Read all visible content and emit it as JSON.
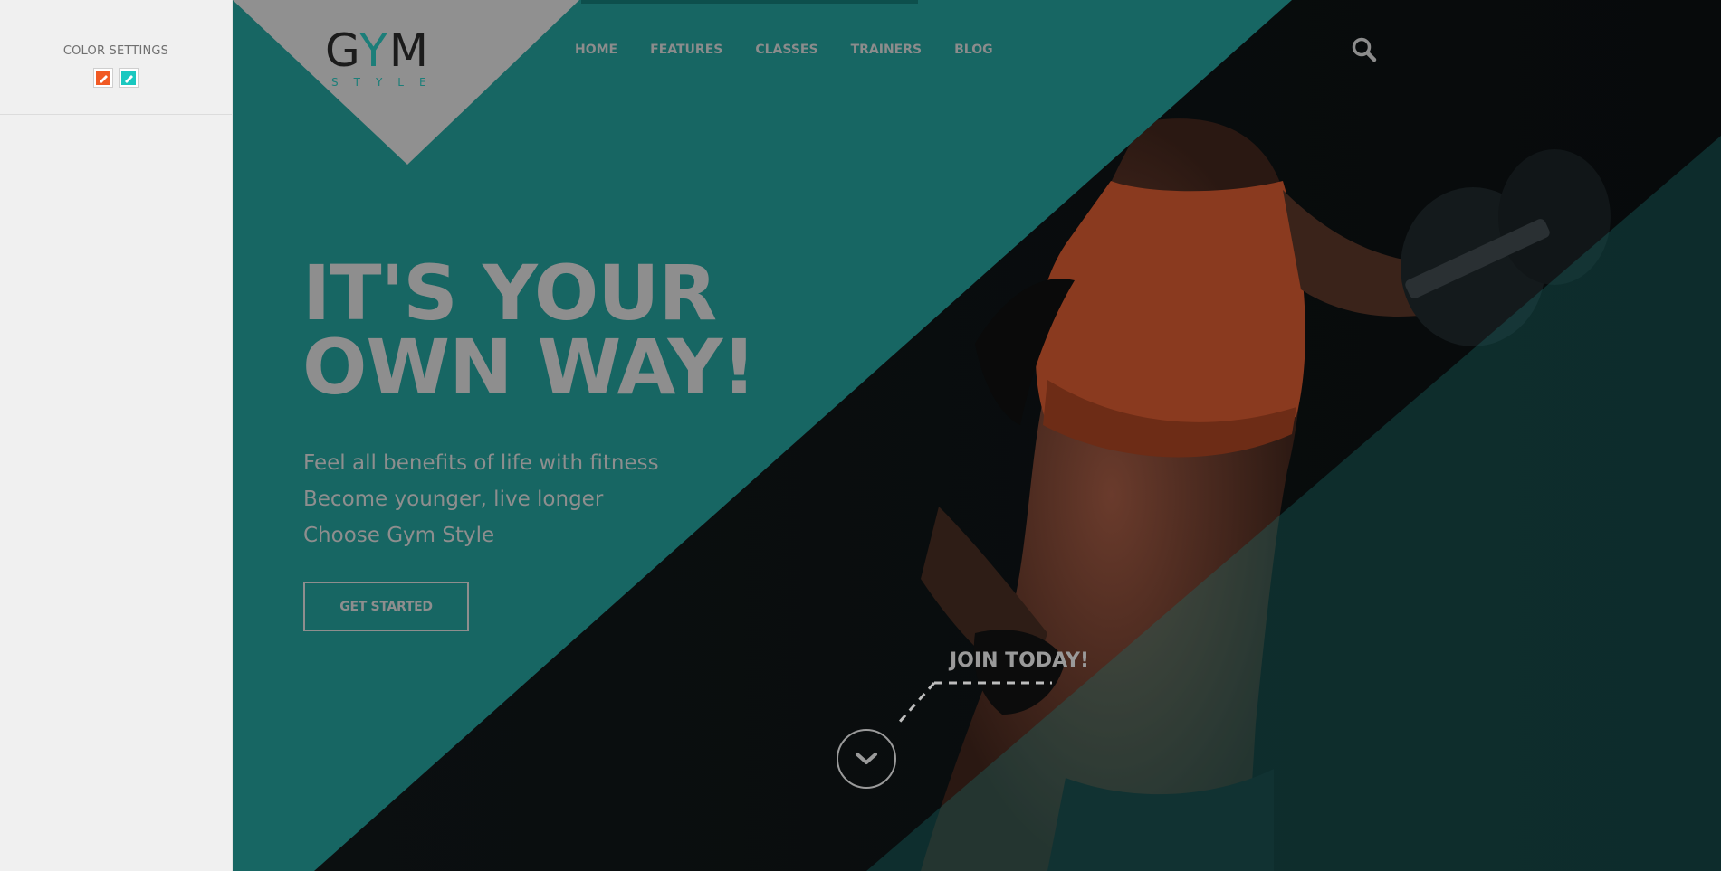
{
  "settings": {
    "title": "COLOR SETTINGS",
    "swatches": [
      {
        "name": "orange",
        "color": "#f15a24"
      },
      {
        "name": "teal",
        "color": "#1ac8c0"
      }
    ]
  },
  "logo": {
    "main_prefix": "G",
    "main_y": "Y",
    "main_suffix": "M",
    "sub": "STYLE"
  },
  "nav": {
    "items": [
      {
        "label": "HOME",
        "active": true
      },
      {
        "label": "FEATURES",
        "active": false
      },
      {
        "label": "CLASSES",
        "active": false
      },
      {
        "label": "TRAINERS",
        "active": false
      },
      {
        "label": "BLOG",
        "active": false
      }
    ],
    "search_icon": "search-icon"
  },
  "hero": {
    "headline_line1": "IT'S YOUR",
    "headline_line2": "OWN WAY!",
    "taglines": [
      "Feel all benefits of life with fitness",
      "Become younger, live longer",
      "Choose Gym Style"
    ],
    "cta_label": "GET STARTED",
    "join_label": "JOIN TODAY!",
    "scroll_icon": "chevron-down-icon"
  },
  "colors": {
    "accent_teal": "#176663",
    "text_gray": "#8e8e8e",
    "logo_triangle": "#909090"
  }
}
